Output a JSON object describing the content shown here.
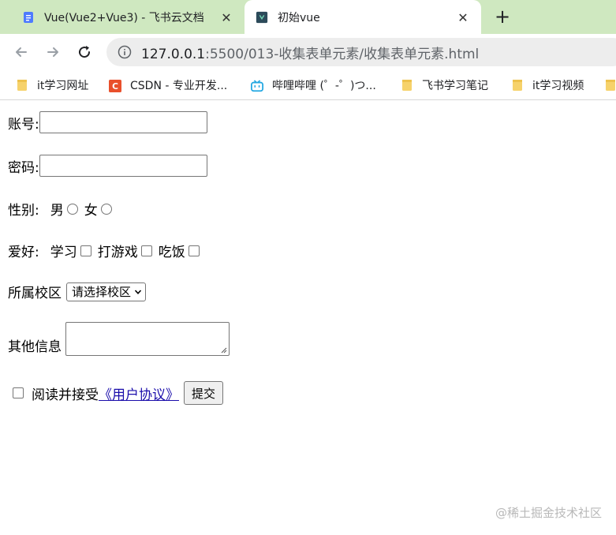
{
  "tabs": [
    {
      "title": "Vue(Vue2+Vue3) - 飞书云文档",
      "active": false,
      "icon": "doc-icon"
    },
    {
      "title": "初始vue",
      "active": true,
      "icon": "page-icon"
    }
  ],
  "toolbar": {
    "url_host": "127.0.0.1",
    "url_rest": ":5500/013-收集表单元素/收集表单元素.html"
  },
  "bookmarks": [
    {
      "label": "it学习网址",
      "icon": "folder-icon"
    },
    {
      "label": "CSDN - 专业开发...",
      "icon": "csdn-icon"
    },
    {
      "label": "哔哩哔哩 (゜-゜)つ...",
      "icon": "bilibili-icon"
    },
    {
      "label": "飞书学习笔记",
      "icon": "folder-icon"
    },
    {
      "label": "it学习视频",
      "icon": "folder-icon"
    }
  ],
  "form": {
    "account_label": "账号:",
    "account_value": "",
    "password_label": "密码:",
    "password_value": "",
    "gender_label": "性别:",
    "gender_male": "男",
    "gender_female": "女",
    "hobby_label": "爱好:",
    "hobby_study": "学习",
    "hobby_game": "打游戏",
    "hobby_eat": "吃饭",
    "campus_label": "所属校区",
    "campus_selected": "请选择校区",
    "other_label": "其他信息",
    "agree_text": "阅读并接受",
    "agree_link": "《用户协议》",
    "submit_label": "提交"
  },
  "watermark": "@稀土掘金技术社区",
  "colors": {
    "tabstrip": "#cfe8c0",
    "link": "#1a0dab",
    "omnibox": "#ededed"
  }
}
